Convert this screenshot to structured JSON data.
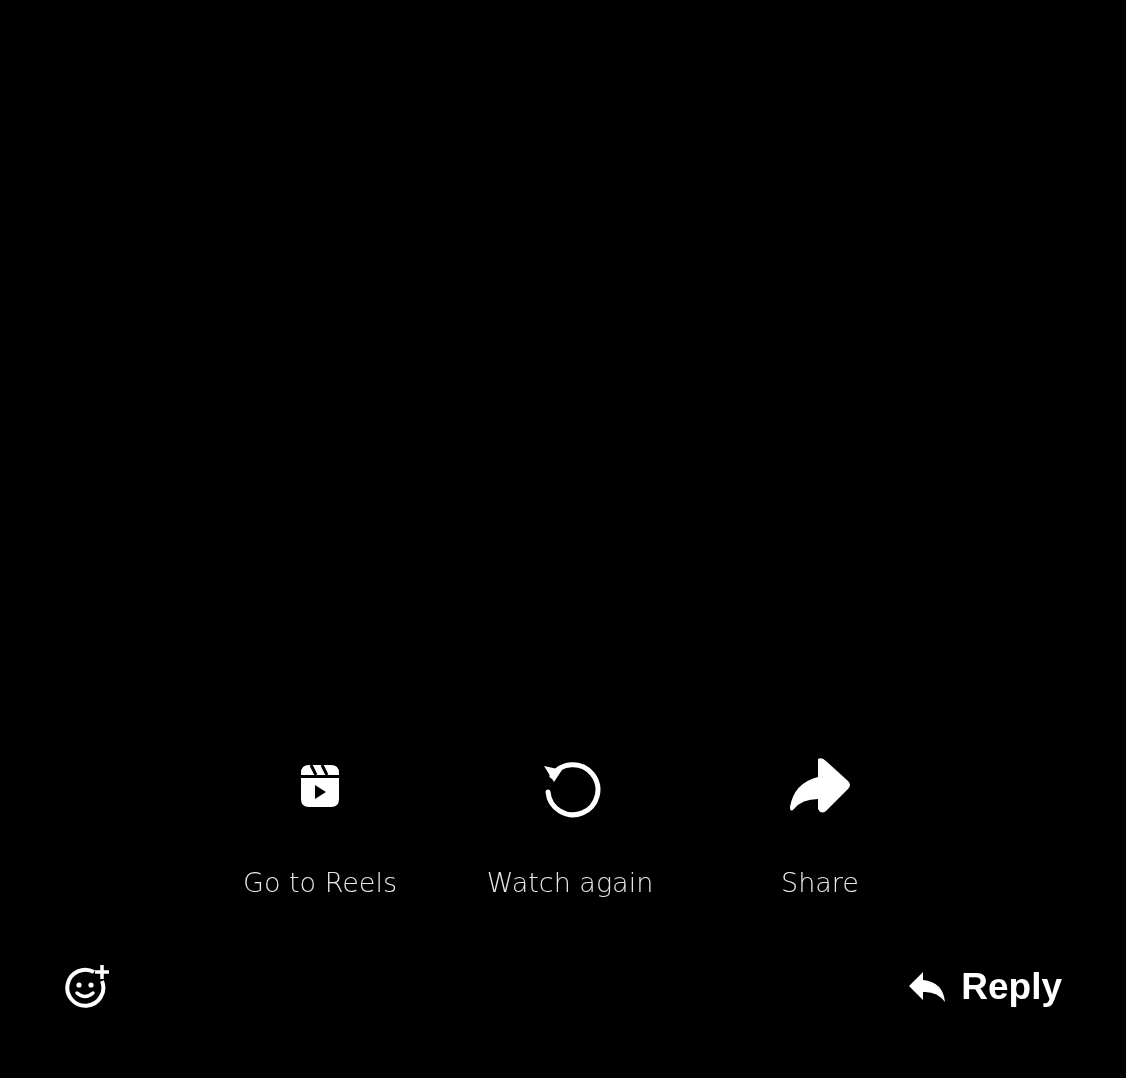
{
  "actions": [
    {
      "kind": "reels",
      "label": "Go to Reels"
    },
    {
      "kind": "replay",
      "label": "Watch again"
    },
    {
      "kind": "share",
      "label": "Share"
    }
  ],
  "footer": {
    "reply": "Reply"
  }
}
